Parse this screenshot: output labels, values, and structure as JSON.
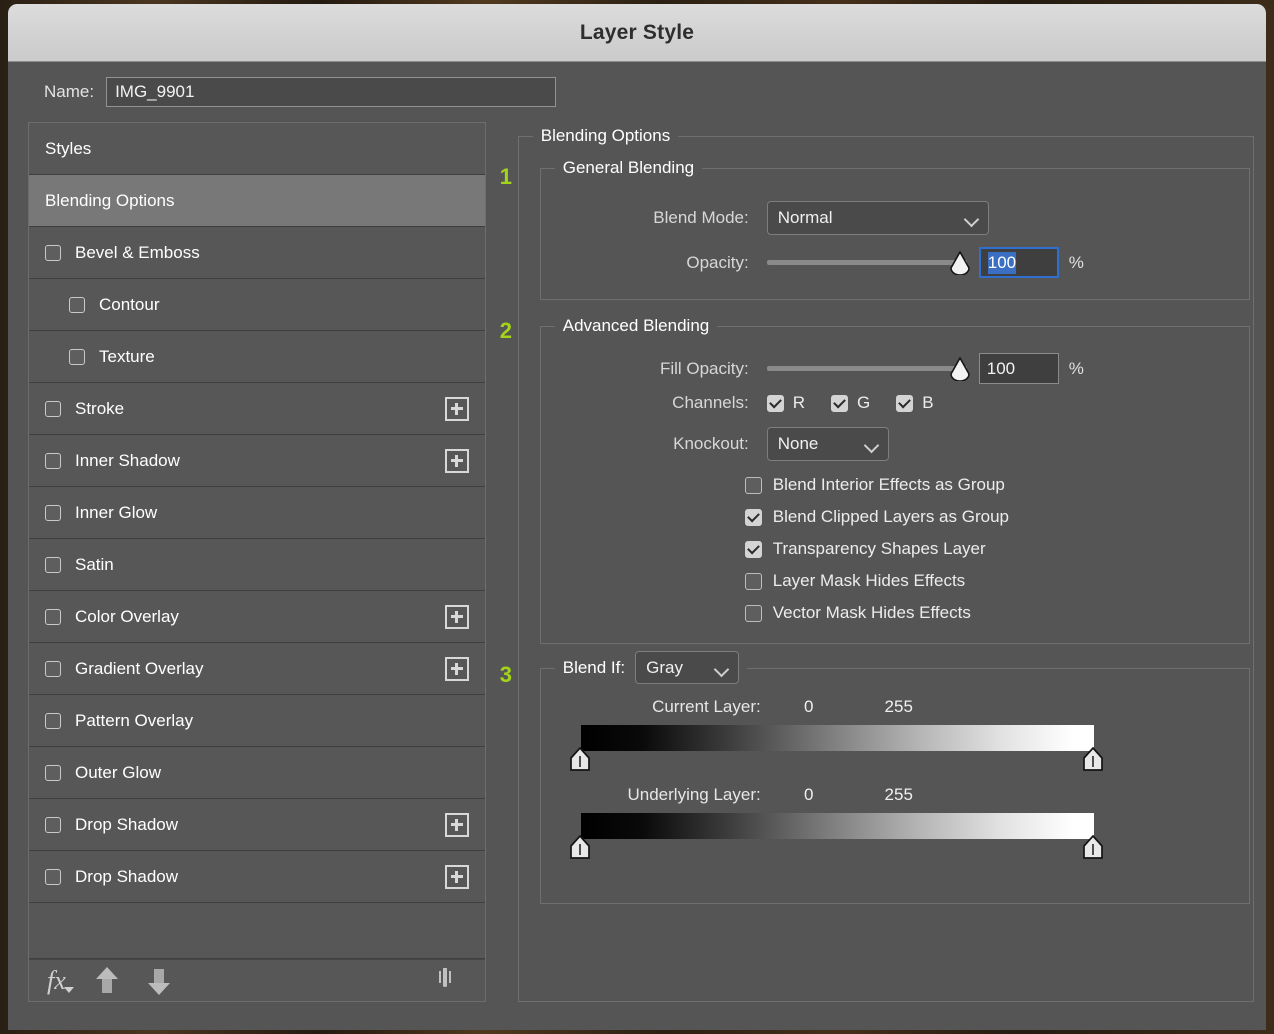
{
  "dialog": {
    "title": "Layer Style"
  },
  "name_field": {
    "label": "Name:",
    "value": "IMG_9901"
  },
  "sidebar": {
    "items": [
      {
        "label": "Styles",
        "type": "header",
        "selected": false,
        "checkbox": false,
        "checked": false,
        "plus": false,
        "indent": false
      },
      {
        "label": "Blending Options",
        "type": "header",
        "selected": true,
        "checkbox": false,
        "checked": false,
        "plus": false,
        "indent": false
      },
      {
        "label": "Bevel & Emboss",
        "type": "effect",
        "selected": false,
        "checkbox": true,
        "checked": false,
        "plus": false,
        "indent": false
      },
      {
        "label": "Contour",
        "type": "effect",
        "selected": false,
        "checkbox": true,
        "checked": false,
        "plus": false,
        "indent": true
      },
      {
        "label": "Texture",
        "type": "effect",
        "selected": false,
        "checkbox": true,
        "checked": false,
        "plus": false,
        "indent": true
      },
      {
        "label": "Stroke",
        "type": "effect",
        "selected": false,
        "checkbox": true,
        "checked": false,
        "plus": true,
        "indent": false
      },
      {
        "label": "Inner Shadow",
        "type": "effect",
        "selected": false,
        "checkbox": true,
        "checked": false,
        "plus": true,
        "indent": false
      },
      {
        "label": "Inner Glow",
        "type": "effect",
        "selected": false,
        "checkbox": true,
        "checked": false,
        "plus": false,
        "indent": false
      },
      {
        "label": "Satin",
        "type": "effect",
        "selected": false,
        "checkbox": true,
        "checked": false,
        "plus": false,
        "indent": false
      },
      {
        "label": "Color Overlay",
        "type": "effect",
        "selected": false,
        "checkbox": true,
        "checked": false,
        "plus": true,
        "indent": false
      },
      {
        "label": "Gradient Overlay",
        "type": "effect",
        "selected": false,
        "checkbox": true,
        "checked": false,
        "plus": true,
        "indent": false
      },
      {
        "label": "Pattern Overlay",
        "type": "effect",
        "selected": false,
        "checkbox": true,
        "checked": false,
        "plus": false,
        "indent": false
      },
      {
        "label": "Outer Glow",
        "type": "effect",
        "selected": false,
        "checkbox": true,
        "checked": false,
        "plus": false,
        "indent": false
      },
      {
        "label": "Drop Shadow",
        "type": "effect",
        "selected": false,
        "checkbox": true,
        "checked": false,
        "plus": true,
        "indent": false
      },
      {
        "label": "Drop Shadow",
        "type": "effect",
        "selected": false,
        "checkbox": true,
        "checked": false,
        "plus": true,
        "indent": false
      }
    ],
    "toolbar": {
      "fx_icon": "fx-icon",
      "move_up_icon": "arrow-up-icon",
      "move_down_icon": "arrow-down-icon",
      "delete_icon": "trash-icon"
    }
  },
  "blending_options": {
    "legend": "Blending Options",
    "general": {
      "legend": "General Blending",
      "annotation": "1",
      "blend_mode_label": "Blend Mode:",
      "blend_mode_value": "Normal",
      "opacity_label": "Opacity:",
      "opacity_value": "100",
      "opacity_percent_sign": "%",
      "opacity_slider_position_percent": 100
    },
    "advanced": {
      "legend": "Advanced Blending",
      "annotation": "2",
      "fill_opacity_label": "Fill Opacity:",
      "fill_opacity_value": "100",
      "fill_opacity_percent_sign": "%",
      "fill_opacity_slider_position_percent": 100,
      "channels_label": "Channels:",
      "channels": [
        {
          "label": "R",
          "checked": true
        },
        {
          "label": "G",
          "checked": true
        },
        {
          "label": "B",
          "checked": true
        }
      ],
      "knockout_label": "Knockout:",
      "knockout_value": "None",
      "options": [
        {
          "label": "Blend Interior Effects as Group",
          "checked": false
        },
        {
          "label": "Blend Clipped Layers as Group",
          "checked": true
        },
        {
          "label": "Transparency Shapes Layer",
          "checked": true
        },
        {
          "label": "Layer Mask Hides Effects",
          "checked": false
        },
        {
          "label": "Vector Mask Hides Effects",
          "checked": false
        }
      ]
    },
    "blend_if": {
      "legend": "Blend If:",
      "annotation": "3",
      "channel_value": "Gray",
      "current_layer": {
        "label": "Current Layer:",
        "black_value": "0",
        "white_value": "255"
      },
      "underlying_layer": {
        "label": "Underlying Layer:",
        "black_value": "0",
        "white_value": "255"
      }
    }
  },
  "colors": {
    "dialog_bg": "#555555",
    "titlebar_bg": "#d4d4d4",
    "list_row_bg": "#575757",
    "selected_row_bg": "#787878",
    "accent_focus": "#2f6fd0",
    "selection_highlight": "#3a6fc4",
    "annotation": "#a4d418"
  }
}
